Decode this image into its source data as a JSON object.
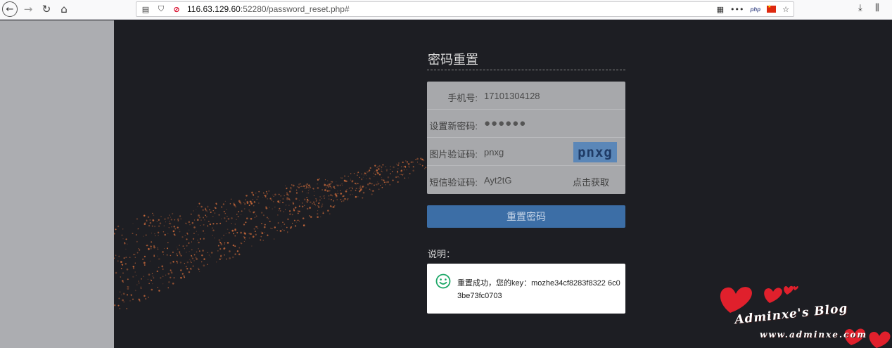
{
  "browser": {
    "url_host": "116.63.129.60",
    "url_rest": ":52280/password_reset.php#",
    "php_badge": "php"
  },
  "form": {
    "title": "密码重置",
    "rows": [
      {
        "label": "手机号:",
        "value": "17101304128"
      },
      {
        "label": "设置新密码:",
        "value": "●●●●●●"
      },
      {
        "label": "图片验证码:",
        "value": "pnxg"
      },
      {
        "label": "短信验证码:",
        "value": "Ayt2tG"
      }
    ],
    "captcha_text": "pnxg",
    "sms_button": "点击获取",
    "submit_button": "重置密码"
  },
  "note": {
    "label": "说明：",
    "message": "重置成功，您的key：mozhe34cf8283f8322 6c03be73fc0703"
  },
  "watermark": {
    "title": "Adminxe's Blog",
    "url": "www.adminxe.com"
  },
  "colors": {
    "stage_bg": "#1d1e23",
    "button_blue": "#3c6ea6",
    "spark": "#c8693a",
    "heart": "#e0202c"
  }
}
